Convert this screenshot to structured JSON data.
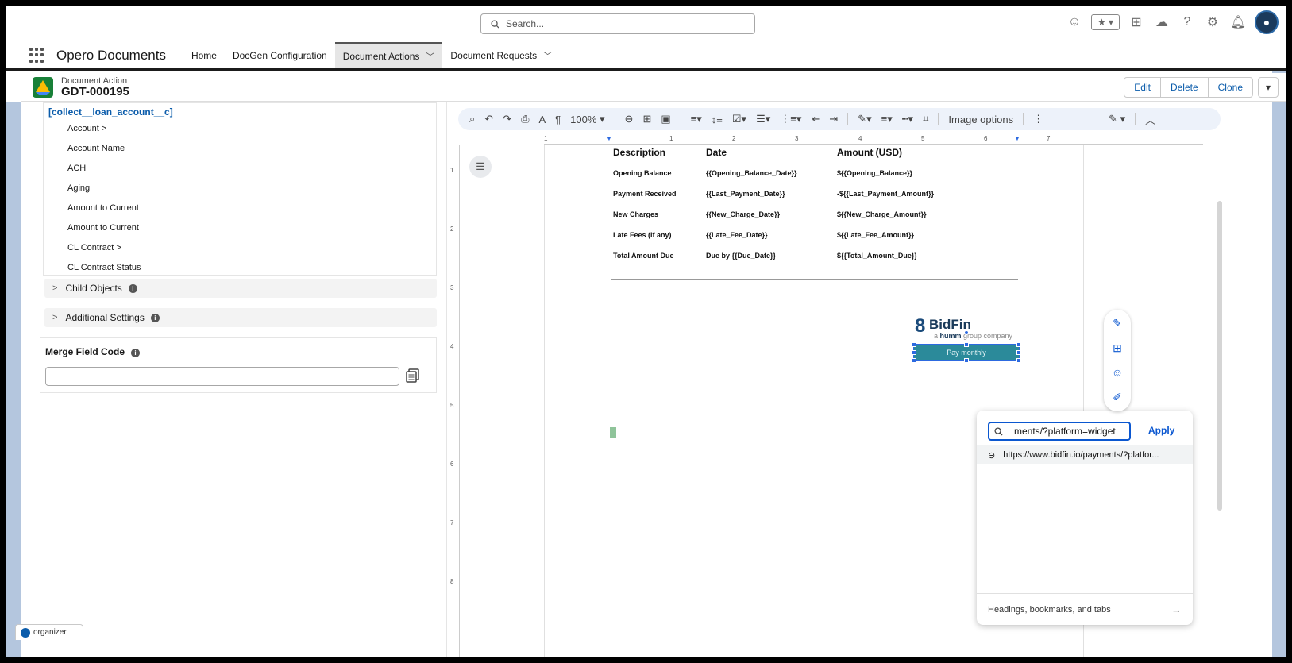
{
  "global_header": {
    "search_placeholder": "Search..."
  },
  "app_nav": {
    "app_name": "Opero Documents",
    "tabs": [
      {
        "label": "Home"
      },
      {
        "label": "DocGen Configuration"
      },
      {
        "label": "Document Actions"
      },
      {
        "label": "Document Requests"
      }
    ]
  },
  "record": {
    "object_label": "Document Action",
    "name": "GDT-000195",
    "actions": {
      "edit": "Edit",
      "delete": "Delete",
      "clone": "Clone"
    }
  },
  "field_panel": {
    "object_name": "[collect__loan_account__c]",
    "fields": [
      "Account >",
      "Account Name",
      "ACH",
      "Aging",
      "Amount to Current",
      "Amount to Current",
      "CL Contract >",
      "CL Contract Status"
    ],
    "sections": {
      "child_objects": "Child Objects",
      "additional_settings": "Additional Settings"
    },
    "merge_field_label": "Merge Field Code",
    "merge_field_value": ""
  },
  "editor_toolbar": {
    "zoom": "100%",
    "image_options": "Image options"
  },
  "ruler": {
    "h_ticks": [
      "1",
      "1",
      "2",
      "3",
      "4",
      "5",
      "6",
      "7"
    ],
    "v_ticks": [
      "1",
      "2",
      "3",
      "4",
      "5",
      "6",
      "7",
      "8"
    ]
  },
  "document": {
    "table_headers": [
      "Description",
      "Date",
      "Amount (USD)"
    ],
    "rows": [
      [
        "Opening Balance",
        "{{Opening_Balance_Date}}",
        "${{Opening_Balance}}"
      ],
      [
        "Payment Received",
        "{{Last_Payment_Date}}",
        "-${{Last_Payment_Amount}}"
      ],
      [
        "New Charges",
        "{{New_Charge_Date}}",
        "${{New_Charge_Amount}}"
      ],
      [
        "Late Fees (if any)",
        "{{Late_Fee_Date}}",
        "${{Late_Fee_Amount}}"
      ],
      [
        "Total Amount Due",
        "Due by {{Due_Date}}",
        "${{Total_Amount_Due}}"
      ]
    ],
    "logo_name": "BidFin",
    "logo_sub_brand": "humm",
    "logo_sub_pre": "a ",
    "logo_sub_post": " group company",
    "pay_button": "Pay monthly"
  },
  "link_popup": {
    "input_value": "ments/?platform=widget",
    "apply": "Apply",
    "suggestion": "https://www.bidfin.io/payments/?platfor...",
    "footer": "Headings, bookmarks, and tabs"
  },
  "organizer_label": "organizer"
}
